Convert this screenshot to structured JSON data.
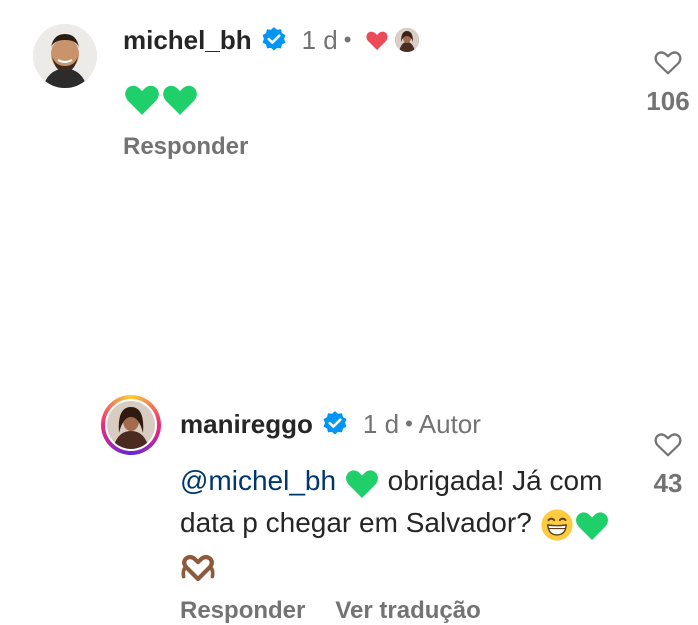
{
  "comments": [
    {
      "username": "michel_bh",
      "verified": true,
      "time": "1 d",
      "separator": "•",
      "text_emoji": "💚💚",
      "actions": {
        "reply": "Responder"
      },
      "likes": "106",
      "liked_by_author": true
    },
    {
      "username": "manireggo",
      "verified": true,
      "time": "1 d",
      "separator": "•",
      "author_tag": "Autor",
      "mention": "@michel_bh",
      "text_after_mention": "obrigada! Já com data p chegar em Salvador?",
      "actions": {
        "reply": "Responder",
        "translate": "Ver tradução"
      },
      "likes": "43"
    }
  ],
  "colors": {
    "text": "#262626",
    "muted": "#737373",
    "mention": "#00376b",
    "verified": "#0095f6",
    "like_heart": "#ed4956",
    "green_heart": "#1fcf6a"
  }
}
